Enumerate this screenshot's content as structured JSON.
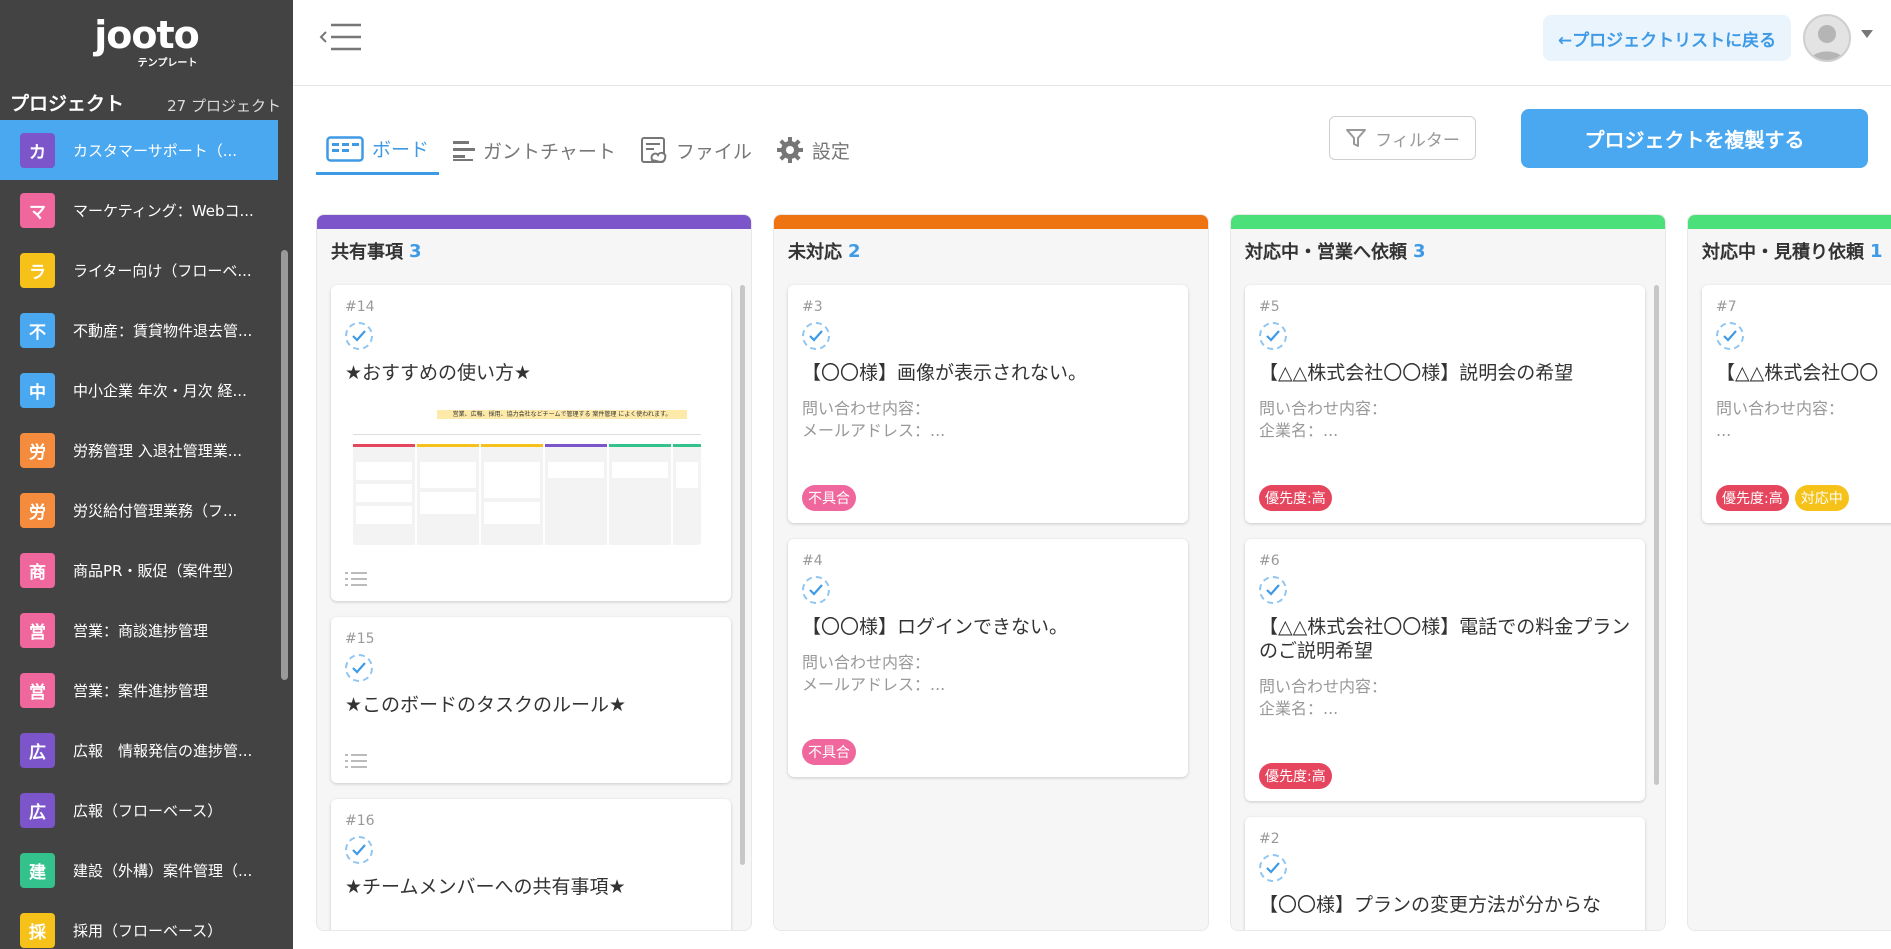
{
  "sidebar": {
    "logo": "jooto",
    "logo_sub": "テンプレート",
    "heading": "プロジェクト",
    "count": "27 プロジェクト",
    "items": [
      {
        "badge": "カ",
        "color": "#7b55c9",
        "label": "カスタマーサポート（..."
      },
      {
        "badge": "マ",
        "color": "#f0679d",
        "label": "マーケティング：Webコ..."
      },
      {
        "badge": "ラ",
        "color": "#f6c21a",
        "label": "ライター向け（フローベ..."
      },
      {
        "badge": "不",
        "color": "#4aa8f0",
        "label": "不動産：賃貸物件退去管..."
      },
      {
        "badge": "中",
        "color": "#4aa8f0",
        "label": "中小企業 年次・月次 経..."
      },
      {
        "badge": "労",
        "color": "#f58b3c",
        "label": "労務管理 入退社管理業..."
      },
      {
        "badge": "労",
        "color": "#f58b3c",
        "label": "労災給付管理業務（フ..."
      },
      {
        "badge": "商",
        "color": "#f0679d",
        "label": "商品PR・販促（案件型）"
      },
      {
        "badge": "営",
        "color": "#f0679d",
        "label": "営業：商談進捗管理"
      },
      {
        "badge": "営",
        "color": "#f0679d",
        "label": "営業：案件進捗管理"
      },
      {
        "badge": "広",
        "color": "#7b55c9",
        "label": "広報　情報発信の進捗管..."
      },
      {
        "badge": "広",
        "color": "#7b55c9",
        "label": "広報（フローベース）"
      },
      {
        "badge": "建",
        "color": "#34c28c",
        "label": "建設（外構）案件管理（..."
      },
      {
        "badge": "採",
        "color": "#f6c21a",
        "label": "採用（フローベース）"
      }
    ]
  },
  "header": {
    "back_label": "←プロジェクトリストに戻る"
  },
  "tabs": [
    {
      "label": "ボード",
      "icon": "board-icon",
      "active": true
    },
    {
      "label": "ガントチャート",
      "icon": "gantt-icon",
      "active": false
    },
    {
      "label": "ファイル",
      "icon": "file-icon",
      "active": false
    },
    {
      "label": "設定",
      "icon": "gear-icon",
      "active": false
    }
  ],
  "filter_label": "フィルター",
  "duplicate_label": "プロジェクトを複製する",
  "columns": [
    {
      "title": "共有事項",
      "count": "3",
      "color": "#7b55c9",
      "cards": [
        {
          "num": "#14",
          "title": "★おすすめの使い方★",
          "thumb_caption": "営業、広報、採用、協力会社などチームで管理する 案件管理 によく使われます。"
        },
        {
          "num": "#15",
          "title": "★このボードのタスクのルール★"
        },
        {
          "num": "#16",
          "title": "★チームメンバーへの共有事項★"
        }
      ]
    },
    {
      "title": "未対応",
      "count": "2",
      "color": "#ee7411",
      "cards": [
        {
          "num": "#3",
          "title": "【〇〇様】画像が表示されない。",
          "desc": "問い合わせ内容：\nメールアドレス：...",
          "tags": [
            {
              "text": "不具合",
              "color": "#f0679d"
            }
          ]
        },
        {
          "num": "#4",
          "title": "【〇〇様】ログインできない。",
          "desc": "問い合わせ内容：\nメールアドレス：...",
          "tags": [
            {
              "text": "不具合",
              "color": "#f0679d"
            }
          ]
        }
      ]
    },
    {
      "title": "対応中・営業へ依頼",
      "count": "3",
      "color": "#4be07a",
      "cards": [
        {
          "num": "#5",
          "title": "【△△株式会社〇〇様】説明会の希望",
          "desc": "問い合わせ内容：\n企業名：...",
          "tags": [
            {
              "text": "優先度:高",
              "color": "#e5455d"
            }
          ]
        },
        {
          "num": "#6",
          "title": "【△△株式会社〇〇様】電話での料金プランのご説明希望",
          "desc": "問い合わせ内容：\n企業名：...",
          "tags": [
            {
              "text": "優先度:高",
              "color": "#e5455d"
            }
          ]
        },
        {
          "num": "#2",
          "title": "【〇〇様】プランの変更方法が分からな"
        }
      ]
    },
    {
      "title": "対応中・見積り依頼",
      "count": "1",
      "color": "#4be07a",
      "cards": [
        {
          "num": "#7",
          "title": "【△△株式会社〇〇",
          "desc": "問い合わせ内容：\n...",
          "tags": [
            {
              "text": "優先度:高",
              "color": "#e5455d"
            },
            {
              "text": "対応中",
              "color": "#f6c21a"
            }
          ]
        }
      ]
    }
  ]
}
